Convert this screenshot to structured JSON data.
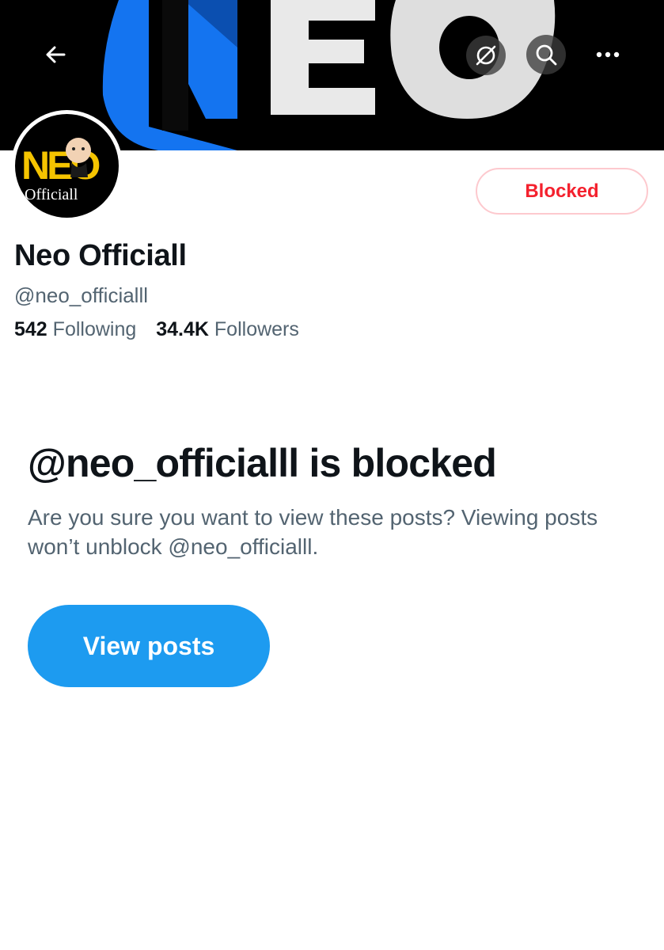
{
  "banner": {
    "logo_text": "NEO"
  },
  "header": {
    "back_icon": "arrow-left-icon",
    "grok_icon": "grok-slash-icon",
    "search_icon": "search-icon",
    "more_icon": "more-horizontal-icon"
  },
  "avatar": {
    "logo_text": "NEO",
    "caption": "Officiall"
  },
  "profile": {
    "blocked_label": "Blocked",
    "display_name": "Neo Officiall",
    "handle": "@neo_officialll",
    "following_count": "542",
    "following_label": "Following",
    "followers_count": "34.4K",
    "followers_label": "Followers"
  },
  "blocked_notice": {
    "title": "@neo_officialll is blocked",
    "description": "Are you sure you want to view these posts? Viewing posts won’t unblock @neo_officialll.",
    "view_button_label": "View posts"
  },
  "colors": {
    "accent": "#1d9bf0",
    "danger": "#f4212e",
    "secondary_text": "#536471",
    "primary_text": "#0f1419"
  }
}
